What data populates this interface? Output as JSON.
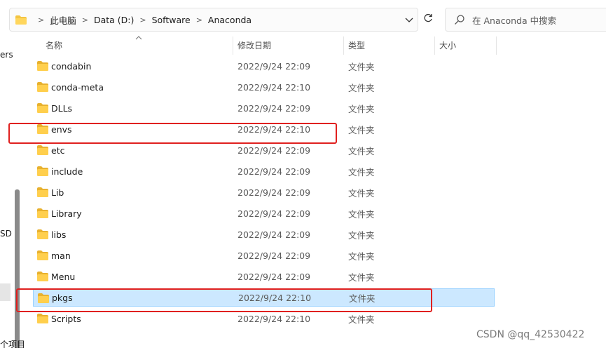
{
  "breadcrumb": [
    "此电脑",
    "Data (D:)",
    "Software",
    "Anaconda"
  ],
  "search": {
    "placeholder": "在 Anaconda 中搜索"
  },
  "nav": {
    "fragments": [
      "ers",
      "SD"
    ]
  },
  "columns": {
    "name": "名称",
    "modified": "修改日期",
    "type": "类型",
    "size": "大小"
  },
  "files": [
    {
      "name": "condabin",
      "modified": "2022/9/24 22:09",
      "type": "文件夹",
      "selected": false
    },
    {
      "name": "conda-meta",
      "modified": "2022/9/24 22:10",
      "type": "文件夹",
      "selected": false
    },
    {
      "name": "DLLs",
      "modified": "2022/9/24 22:09",
      "type": "文件夹",
      "selected": false
    },
    {
      "name": "envs",
      "modified": "2022/9/24 22:10",
      "type": "文件夹",
      "selected": false
    },
    {
      "name": "etc",
      "modified": "2022/9/24 22:09",
      "type": "文件夹",
      "selected": false
    },
    {
      "name": "include",
      "modified": "2022/9/24 22:09",
      "type": "文件夹",
      "selected": false
    },
    {
      "name": "Lib",
      "modified": "2022/9/24 22:09",
      "type": "文件夹",
      "selected": false
    },
    {
      "name": "Library",
      "modified": "2022/9/24 22:09",
      "type": "文件夹",
      "selected": false
    },
    {
      "name": "libs",
      "modified": "2022/9/24 22:09",
      "type": "文件夹",
      "selected": false
    },
    {
      "name": "man",
      "modified": "2022/9/24 22:09",
      "type": "文件夹",
      "selected": false
    },
    {
      "name": "Menu",
      "modified": "2022/9/24 22:09",
      "type": "文件夹",
      "selected": false
    },
    {
      "name": "pkgs",
      "modified": "2022/9/24 22:10",
      "type": "文件夹",
      "selected": true
    },
    {
      "name": "Scripts",
      "modified": "2022/9/24 22:10",
      "type": "文件夹",
      "selected": false
    }
  ],
  "status": {
    "text": "个项目"
  },
  "watermark": "CSDN @qq_42530422",
  "colors": {
    "folder": "#f4c542",
    "selection": "#cce8ff",
    "annotation": "#e0201f"
  },
  "icons": {
    "folder": "folder-icon",
    "separator": "chevron-right-icon",
    "dropdown": "chevron-down-icon",
    "refresh": "refresh-icon",
    "search": "search-icon"
  }
}
